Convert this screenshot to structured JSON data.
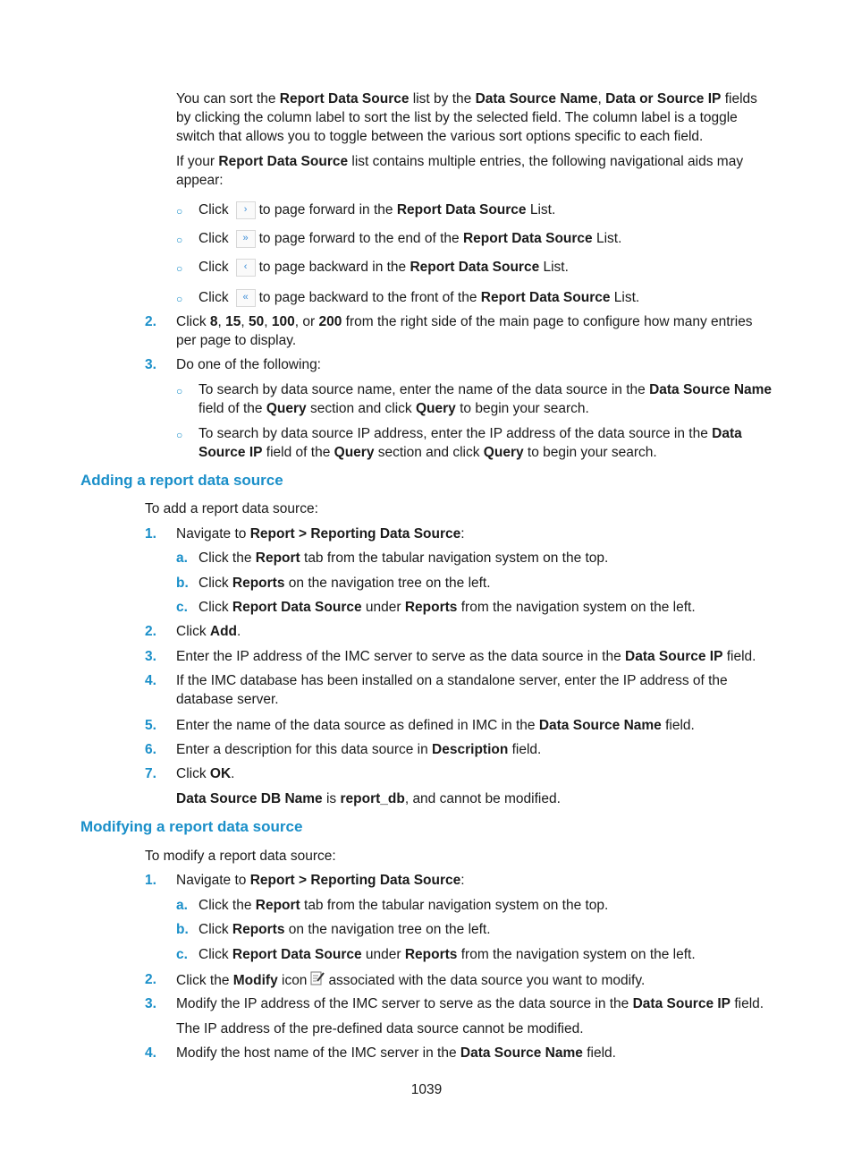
{
  "intro": {
    "p1": [
      "You can sort the ",
      "Report Data Source",
      " list by the ",
      "Data Source Name",
      ", ",
      "Data or Source IP",
      " fields by clicking the column label to sort the list by the selected field. The column label is a toggle switch that allows you to toggle between the various sort options specific to each field."
    ],
    "p2": [
      "If your ",
      "Report Data Source",
      " list contains multiple entries, the following navigational aids may appear:"
    ]
  },
  "nav_aids": [
    {
      "click": "Click",
      "icon": "›",
      "icon_name": "next-page-icon",
      "text": "to page forward in the ",
      "bold": "Report Data Source",
      "tail": " List."
    },
    {
      "click": "Click",
      "icon": "»",
      "icon_name": "last-page-icon",
      "text": "to page forward to the end of the ",
      "bold": "Report Data Source",
      "tail": " List."
    },
    {
      "click": "Click",
      "icon": "‹",
      "icon_name": "previous-page-icon",
      "text": "to page backward in the ",
      "bold": "Report Data Source",
      "tail": " List."
    },
    {
      "click": "Click",
      "icon": "«",
      "icon_name": "first-page-icon",
      "text": "to page backward to the front of the ",
      "bold": "Report Data Source",
      "tail": " List."
    }
  ],
  "steps_top": {
    "s2": {
      "num": "2.",
      "t1": "Click ",
      "b1": "8",
      "t2": ", ",
      "b2": "15",
      "t3": ", ",
      "b3": "50",
      "t4": ", ",
      "b4": "100",
      "t5": ", or ",
      "b5": "200",
      "t6": " from the right side of the main page to configure how many entries per page to display."
    },
    "s3": {
      "num": "3.",
      "text": "Do one of the following:"
    },
    "s3a": {
      "t1": "To search by data source name, enter the name of the data source in the ",
      "b1": "Data Source Name",
      "t2": " field of the ",
      "b2": "Query",
      "t3": " section and click ",
      "b3": "Query",
      "t4": " to begin your search."
    },
    "s3b": {
      "t1": "To search by data source IP address, enter the IP address of the data source in the ",
      "b1": "Data Source IP",
      "t2": " field of the ",
      "b2": "Query",
      "t3": " section and click ",
      "b3": "Query",
      "t4": " to begin your search."
    }
  },
  "add_section": {
    "heading": "Adding a report data source",
    "intro": "To add a report data source:",
    "s1": {
      "num": "1.",
      "t1": "Navigate to ",
      "b1": "Report > Reporting Data Source",
      "t2": ":"
    },
    "s1a": {
      "letter": "a.",
      "t1": "Click the ",
      "b1": "Report",
      "t2": " tab from the tabular navigation system on the top."
    },
    "s1b": {
      "letter": "b.",
      "t1": "Click ",
      "b1": "Reports",
      "t2": " on the navigation tree on the left."
    },
    "s1c": {
      "letter": "c.",
      "t1": "Click ",
      "b1": "Report Data Source",
      "t2": " under ",
      "b2": "Reports",
      "t3": " from the navigation system on the left."
    },
    "s2": {
      "num": "2.",
      "t1": "Click ",
      "b1": "Add",
      "t2": "."
    },
    "s3": {
      "num": "3.",
      "t1": "Enter the IP address of the IMC server to serve as the data source in the ",
      "b1": "Data Source IP",
      "t2": " field."
    },
    "s4": {
      "num": "4.",
      "text": "If the IMC database has been installed on a standalone server, enter the IP address of the database server."
    },
    "s5": {
      "num": "5.",
      "t1": "Enter the name of the data source as defined in IMC in the ",
      "b1": "Data Source Name",
      "t2": " field."
    },
    "s6": {
      "num": "6.",
      "t1": "Enter a description for this data source in ",
      "b1": "Description",
      "t2": " field."
    },
    "s7": {
      "num": "7.",
      "t1": "Click ",
      "b1": "OK",
      "t2": "."
    },
    "note": {
      "b1": "Data Source DB Name",
      "t1": " is ",
      "b2": "report_db",
      "t2": ", and cannot be modified."
    }
  },
  "modify_section": {
    "heading": "Modifying a report data source",
    "intro": "To modify a report data source:",
    "s1": {
      "num": "1.",
      "t1": "Navigate to ",
      "b1": "Report > Reporting Data Source",
      "t2": ":"
    },
    "s1a": {
      "letter": "a.",
      "t1": "Click the ",
      "b1": "Report",
      "t2": " tab from the tabular navigation system on the top."
    },
    "s1b": {
      "letter": "b.",
      "t1": "Click ",
      "b1": "Reports",
      "t2": " on the navigation tree on the left."
    },
    "s1c": {
      "letter": "c.",
      "t1": "Click ",
      "b1": "Report Data Source",
      "t2": " under ",
      "b2": "Reports",
      "t3": " from the navigation system on the left."
    },
    "s2": {
      "num": "2.",
      "t1": "Click the ",
      "b1": "Modify",
      "t2": " icon",
      "t3": "associated with the data source you want to modify."
    },
    "s3": {
      "num": "3.",
      "t1": "Modify the IP address of the IMC server to serve as the data source in the ",
      "b1": "Data Source IP",
      "t2": " field."
    },
    "s3_note": "The IP address of the pre-defined data source cannot be modified.",
    "s4": {
      "num": "4.",
      "t1": "Modify the host name of the IMC server in the ",
      "b1": "Data Source Name",
      "t2": " field."
    }
  },
  "footer": {
    "page_number": "1039"
  },
  "colors": {
    "accent": "#1a8fc9",
    "text": "#1a1a1a"
  }
}
